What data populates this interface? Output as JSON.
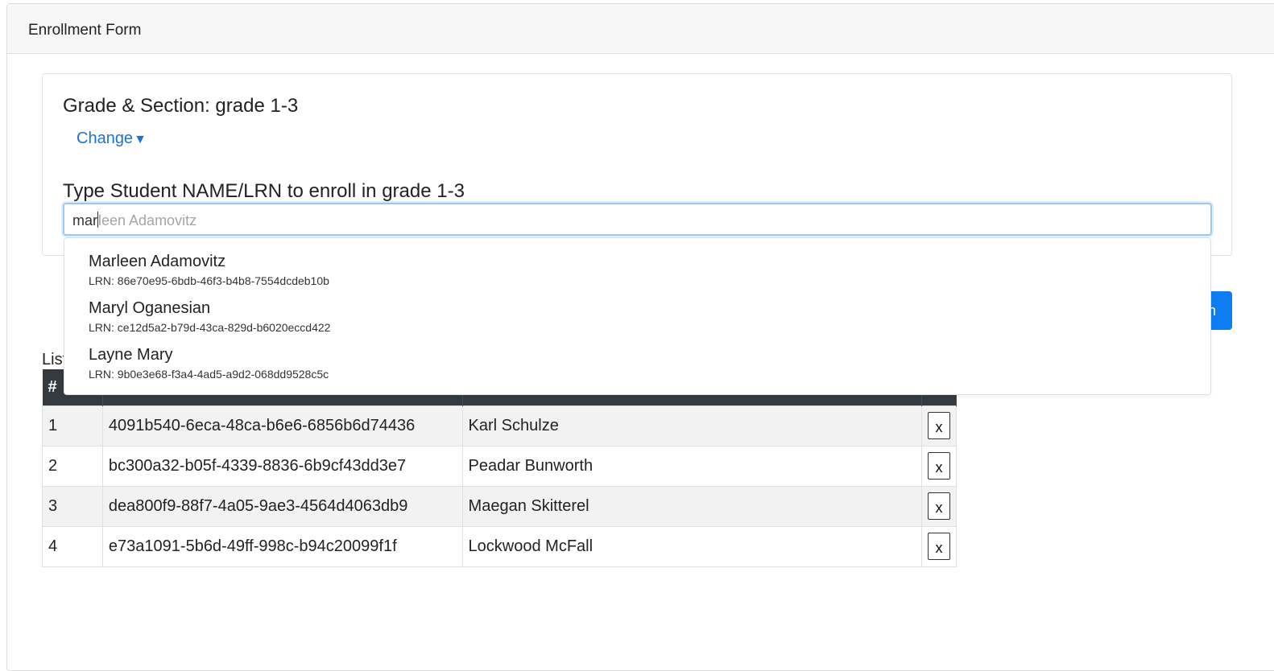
{
  "header": {
    "title": "Enrollment Form"
  },
  "section": {
    "grade_title": "Grade & Section: grade 1-3",
    "change_label": "Change",
    "change_caret": "▼",
    "type_label": "Type Student NAME/LRN to enroll in grade 1-3"
  },
  "search": {
    "typed_value": "mar",
    "autocomplete_hint": "leen Adamovitz"
  },
  "suggestions": [
    {
      "name": "Marleen Adamovitz",
      "lrn": "LRN: 86e70e95-6bdb-46f3-b4b8-7554dcdeb10b"
    },
    {
      "name": "Maryl Oganesian",
      "lrn": "LRN: ce12d5a2-b79d-43ca-829d-b6020eccd422"
    },
    {
      "name": "Layne Mary",
      "lrn": "LRN: 9b0e3e68-f3a4-4ad5-a9d2-068dd9528c5c"
    }
  ],
  "partial_button_label": "h",
  "list_label": "List",
  "table": {
    "headers": [
      "#",
      "",
      "",
      ""
    ],
    "rows": [
      {
        "num": "1",
        "lrn": "4091b540-6eca-48ca-b6e6-6856b6d74436",
        "name": "Karl Schulze",
        "action": "x"
      },
      {
        "num": "2",
        "lrn": "bc300a32-b05f-4339-8836-6b9cf43dd3e7",
        "name": "Peadar Bunworth",
        "action": "x"
      },
      {
        "num": "3",
        "lrn": "dea800f9-88f7-4a05-9ae3-4564d4063db9",
        "name": "Maegan Skitterel",
        "action": "x"
      },
      {
        "num": "4",
        "lrn": "e73a1091-5b6d-49ff-998c-b94c20099f1f",
        "name": "Lockwood McFall",
        "action": "x"
      }
    ]
  },
  "colors": {
    "accent": "#0d7ef2",
    "link": "#1a73d9",
    "table_header": "#343a40"
  }
}
